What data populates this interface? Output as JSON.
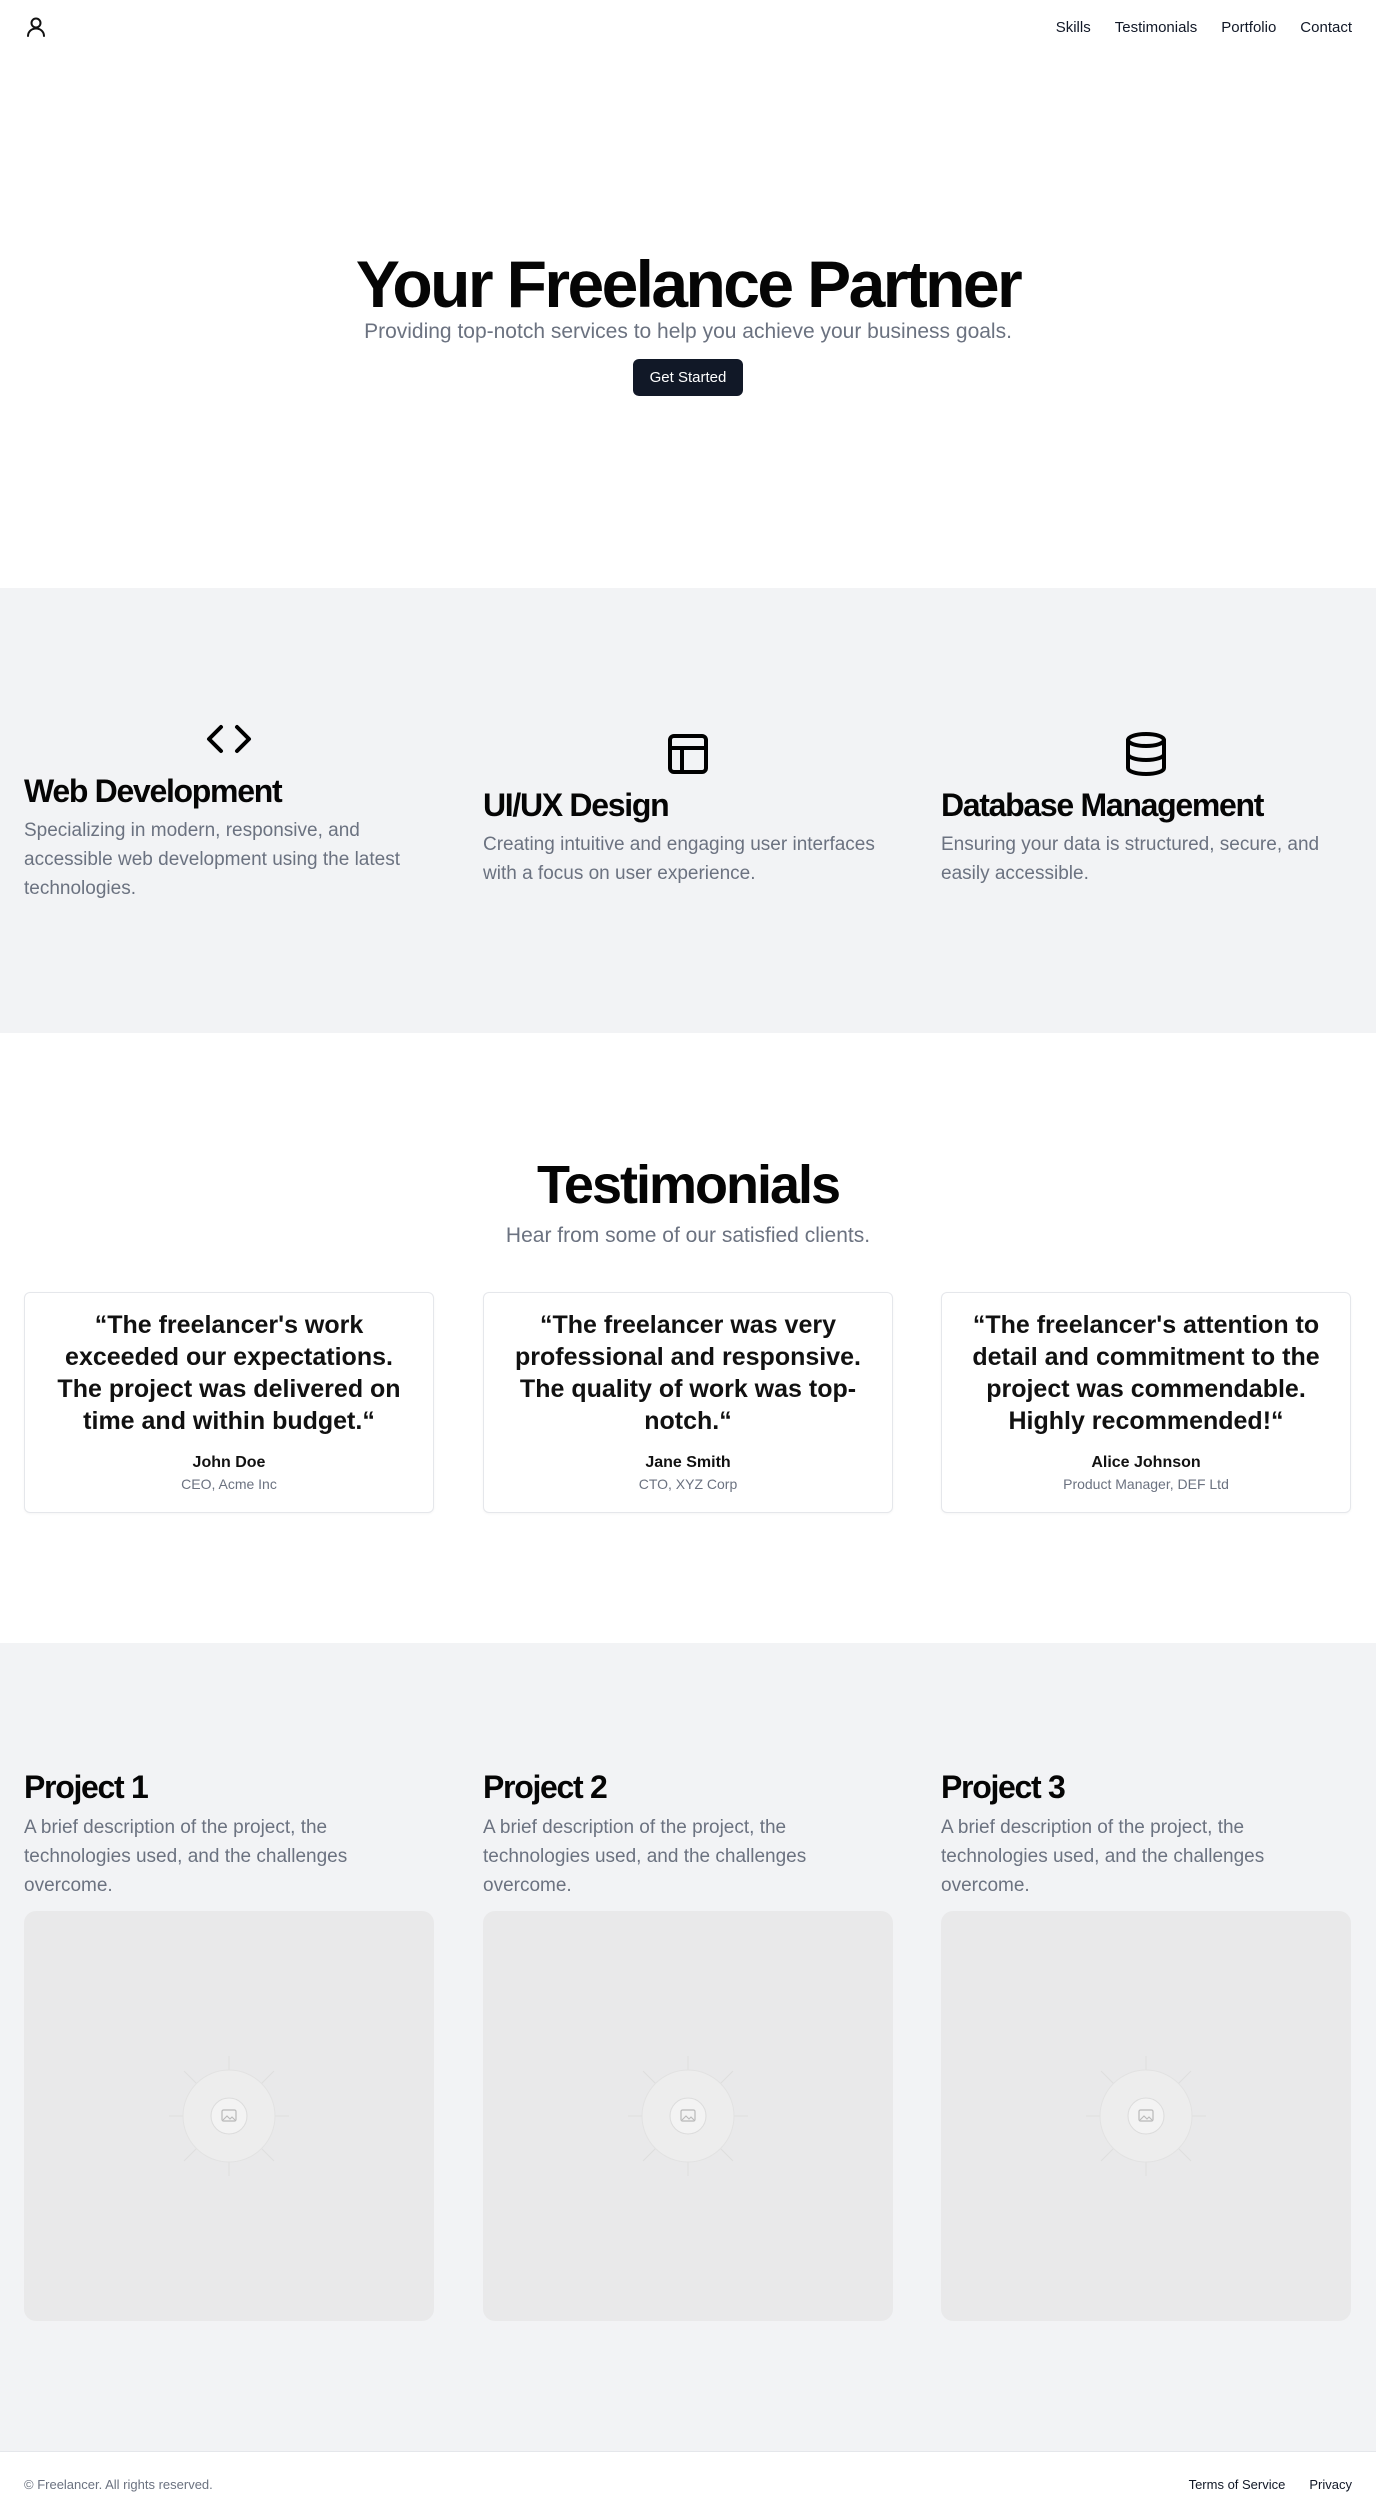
{
  "header": {
    "logo_icon": "user-icon",
    "nav": [
      {
        "label": "Skills"
      },
      {
        "label": "Testimonials"
      },
      {
        "label": "Portfolio"
      },
      {
        "label": "Contact"
      }
    ]
  },
  "hero": {
    "title": "Your Freelance Partner",
    "subtitle": "Providing top-notch services to help you achieve your business goals.",
    "cta_label": "Get Started"
  },
  "skills": [
    {
      "icon": "code-icon",
      "title": "Web Development",
      "description": "Specializing in modern, responsive, and accessible web development using the latest technologies."
    },
    {
      "icon": "layout-icon",
      "title": "UI/UX Design",
      "description": "Creating intuitive and engaging user interfaces with a focus on user experience."
    },
    {
      "icon": "database-icon",
      "title": "Database Management",
      "description": "Ensuring your data is structured, secure, and easily accessible."
    }
  ],
  "testimonials": {
    "title": "Testimonials",
    "subtitle": "Hear from some of our satisfied clients.",
    "items": [
      {
        "quote": "“The freelancer's work exceeded our expectations. The project was delivered on time and within budget.“",
        "name": "John Doe",
        "role": "CEO, Acme Inc"
      },
      {
        "quote": "“The freelancer was very professional and responsive. The quality of work was top-notch.“",
        "name": "Jane Smith",
        "role": "CTO, XYZ Corp"
      },
      {
        "quote": "“The freelancer's attention to detail and commitment to the project was commendable. Highly recommended!“",
        "name": "Alice Johnson",
        "role": "Product Manager, DEF Ltd"
      }
    ]
  },
  "portfolio": [
    {
      "title": "Project 1",
      "description": "A brief description of the project, the technologies used, and the challenges overcome.",
      "image_icon": "image-placeholder-icon"
    },
    {
      "title": "Project 2",
      "description": "A brief description of the project, the technologies used, and the challenges overcome.",
      "image_icon": "image-placeholder-icon"
    },
    {
      "title": "Project 3",
      "description": "A brief description of the project, the technologies used, and the challenges overcome.",
      "image_icon": "image-placeholder-icon"
    }
  ],
  "footer": {
    "copyright": "© Freelancer. All rights reserved.",
    "links": [
      {
        "label": "Terms of Service"
      },
      {
        "label": "Privacy"
      }
    ]
  },
  "colors": {
    "primary_button": "#111827",
    "muted_text": "#6b7280",
    "section_bg": "#f2f3f5",
    "placeholder_bg": "#e9e9ea"
  }
}
